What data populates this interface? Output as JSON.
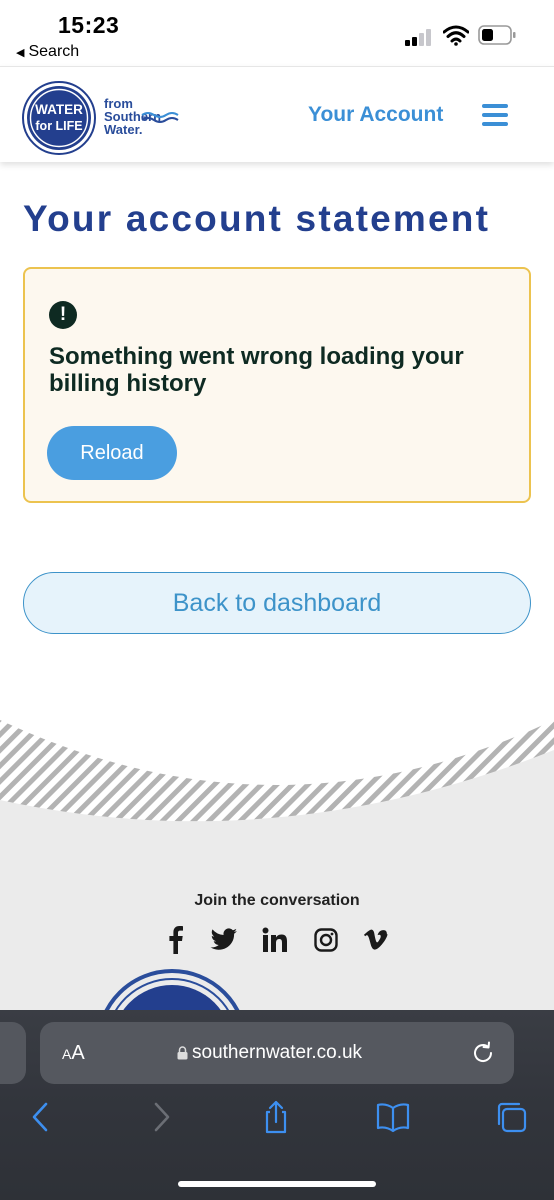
{
  "status_bar": {
    "time": "15:23",
    "back_label": "Search",
    "back_icon": "triangle-left-icon",
    "signal_icon": "cellular-signal-icon",
    "wifi_icon": "wifi-icon",
    "battery_icon": "battery-icon"
  },
  "header": {
    "logo_line1": "WATER",
    "logo_line2": "for LIFE",
    "logo_side_1": "from",
    "logo_side_2": "Southern",
    "logo_side_3": "Water.",
    "account_link": "Your Account",
    "menu_icon": "hamburger-menu-icon"
  },
  "main": {
    "title": "Your account statement",
    "error": {
      "icon": "exclamation-circle-icon",
      "message": "Something went wrong loading your billing history",
      "reload_label": "Reload"
    },
    "back_label": "Back to dashboard"
  },
  "footer": {
    "join_text": "Join the conversation",
    "socials": [
      "facebook-icon",
      "twitter-icon",
      "linkedin-icon",
      "instagram-icon",
      "vimeo-icon"
    ]
  },
  "browser": {
    "text_size": "AA",
    "url": "southernwater.co.uk",
    "nav_icons": [
      "back-arrow-icon",
      "forward-arrow-icon",
      "share-icon",
      "bookmarks-icon",
      "tabs-icon"
    ]
  },
  "colors": {
    "brand_blue": "#233f8e",
    "link_blue": "#3b8fd6",
    "button_blue": "#4a9ee0",
    "warning_border": "#ecc34f",
    "warning_bg": "#fdf8ef"
  }
}
